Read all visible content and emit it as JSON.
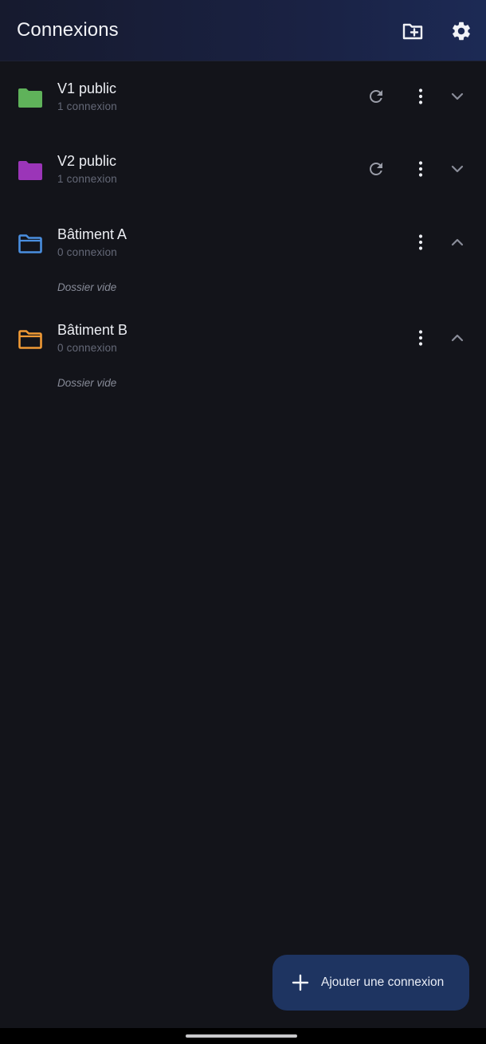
{
  "appbar": {
    "title": "Connexions",
    "new_folder_icon": "create-new-folder-icon",
    "settings_icon": "gear-icon"
  },
  "folders": [
    {
      "name": "V1 public",
      "count": "1 connexion",
      "color": "#5fb25a",
      "icon_style": "filled",
      "expanded": false,
      "has_refresh": true,
      "empty_text": ""
    },
    {
      "name": "V2 public",
      "count": "1 connexion",
      "color": "#9b35b8",
      "icon_style": "filled",
      "expanded": false,
      "has_refresh": true,
      "empty_text": ""
    },
    {
      "name": "Bâtiment A",
      "count": "0 connexion",
      "color": "#4a8fe0",
      "icon_style": "outlined",
      "expanded": true,
      "has_refresh": false,
      "empty_text": "Dossier vide"
    },
    {
      "name": "Bâtiment B",
      "count": "0 connexion",
      "color": "#f09a35",
      "icon_style": "outlined",
      "expanded": true,
      "has_refresh": false,
      "empty_text": "Dossier vide"
    }
  ],
  "fab": {
    "label": "Ajouter une connexion",
    "icon": "plus-icon",
    "background": "#1e3461"
  },
  "colors": {
    "background": "#13141a",
    "icon_gray": "#9a9da8",
    "icon_white": "#eceef3"
  }
}
